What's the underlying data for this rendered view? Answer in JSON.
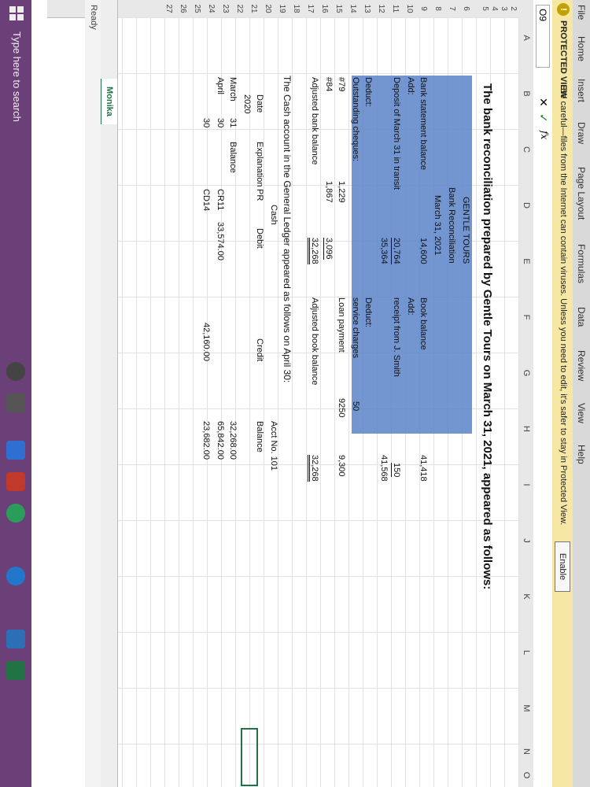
{
  "ribbon_tabs": [
    "File",
    "Home",
    "Insert",
    "Draw",
    "Page Layout",
    "Formulas",
    "Data",
    "Review",
    "View",
    "Help"
  ],
  "protected_view": {
    "title": "PROTECTED VIEW",
    "message": "Be careful—files from the Internet can contain viruses. Unless you need to edit, it's safer to stay in Protected View.",
    "button": "Enable Editing"
  },
  "formula_bar": {
    "name_box": "O9",
    "cancel": "✕",
    "enter": "✓",
    "fx": "fx"
  },
  "columns": [
    "A",
    "B",
    "C",
    "D",
    "E",
    "F",
    "G",
    "H",
    "I",
    "J",
    "K",
    "L",
    "M",
    "N",
    "O"
  ],
  "rows": [
    "2",
    "3",
    "4",
    "5",
    "6",
    "7",
    "8",
    "9",
    "10",
    "11",
    "12",
    "13",
    "14",
    "15",
    "16",
    "17",
    "18",
    "19",
    "20",
    "21",
    "22",
    "23",
    "24",
    "25",
    "26",
    "27"
  ],
  "title": "The bank reconciliation prepared by Gentle Tours on March 31, 2021, appeared as follows:",
  "recon": {
    "company": "GENTLE TOURS",
    "doc": "Bank Reconciliation",
    "date": "March 31, 2021",
    "left": {
      "bank_balance_label": "Bank statement balance",
      "bank_balance": "14,600",
      "add_label": "Add:",
      "deposit_label": "Deposit of March 31 in transit",
      "deposit": "20,764",
      "subtotal": "35,364",
      "deduct_label": "Deduct:",
      "outstanding_label": "Outstanding cheques:",
      "chq1_label": "#79",
      "chq1": "1,229",
      "chq2_label": "#84",
      "chq2": "1,867",
      "chq_total": "3,096",
      "adjusted_label": "Adjusted bank balance",
      "adjusted": "32,268"
    },
    "right": {
      "book_label": "Book balance",
      "book": "41,418",
      "add_label": "Add:",
      "receipt_label": "receipt from J. Smith",
      "receipt": "150",
      "subtotal": "41,568",
      "deduct_label": "Deduct:",
      "service_label": "service charges",
      "service": "50",
      "loan_label": "Loan payment",
      "loan": "9250",
      "deduct_total": "9,300",
      "adjusted_label": "Adjusted book balance",
      "adjusted": "32,268"
    }
  },
  "ledger": {
    "intro": "The Cash account in the General Ledger appeared as follows on April 30:",
    "account_name": "Cash",
    "account_no": "Acct No. 101",
    "headers": {
      "date": "Date",
      "explanation": "Explanation",
      "pr": "PR",
      "debit": "Debit",
      "credit": "Credit",
      "balance": "Balance"
    },
    "year": "2020",
    "rows": [
      {
        "month": "March",
        "day": "31",
        "explanation": "Balance",
        "pr": "",
        "debit": "",
        "credit": "",
        "balance": "32,268.00"
      },
      {
        "month": "April",
        "day": "30",
        "explanation": "",
        "pr": "CR11",
        "debit": "33,574.00",
        "credit": "",
        "balance": "65,842.00"
      },
      {
        "month": "",
        "day": "30",
        "explanation": "",
        "pr": "CD14",
        "debit": "",
        "credit": "42,160.00",
        "balance": "23,682.00"
      }
    ]
  },
  "sheet_tab": "Monika",
  "status": "Ready",
  "taskbar": {
    "search_placeholder": "Type here to search"
  }
}
